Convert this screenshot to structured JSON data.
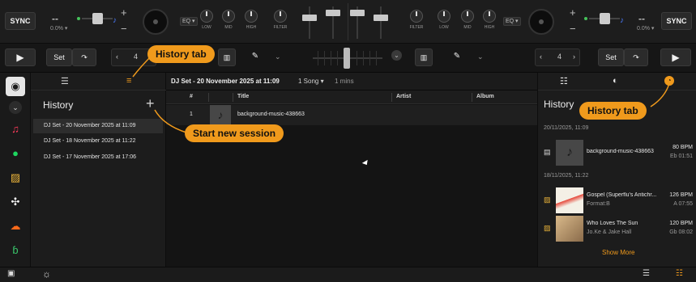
{
  "deck": {
    "sync_label": "SYNC",
    "bpm_display": "--",
    "pitch_pct": "0.0% ▾",
    "plus": "+",
    "minus": "−",
    "eq_label": "EQ ▾",
    "knobs": [
      "LOW",
      "MID",
      "HIGH",
      "FILTER"
    ]
  },
  "transport": {
    "set_label": "Set",
    "loop_value": "4"
  },
  "history_sidebar": {
    "title": "History",
    "add_icon": "plus-icon",
    "sessions": [
      "DJ Set - 20 November 2025 at 11:09",
      "DJ Set - 18 November 2025 at 11:22",
      "DJ Set - 17 November 2025 at 17:06"
    ]
  },
  "list": {
    "header_title": "DJ Set - 20 November 2025 at 11:09",
    "song_count": "1 Song ▾",
    "duration": "1 mins",
    "columns": {
      "num": "#",
      "title": "Title",
      "artist": "Artist",
      "album": "Album"
    },
    "rows": [
      {
        "num": "1",
        "title": "background-music-438663",
        "artist": "",
        "album": ""
      }
    ]
  },
  "right_panel": {
    "title": "History",
    "groups": [
      {
        "date": "20/11/2025, 11:09",
        "tracks": [
          {
            "title": "background-music-438663",
            "sub": "",
            "bpm": "80 BPM",
            "key_time": "Eb  01:51"
          }
        ]
      },
      {
        "date": "18/11/2025, 11:22",
        "tracks": [
          {
            "title": "Gospel (Superflu's Antichr...",
            "sub": "Format:B",
            "bpm": "126 BPM",
            "key_time": "A  07:55"
          },
          {
            "title": "Who Loves The Sun",
            "sub": "Jo.Ke & Jake Hall",
            "bpm": "120 BPM",
            "key_time": "Gb  08:02"
          }
        ]
      }
    ],
    "show_more": "Show More"
  },
  "callouts": {
    "history_tab_left": "History tab",
    "history_tab_right": "History tab",
    "start_new_session": "Start new session"
  },
  "colors": {
    "accent": "#f09a1c",
    "background": "#151515",
    "green": "#46c35b",
    "blue": "#4a7cff"
  }
}
